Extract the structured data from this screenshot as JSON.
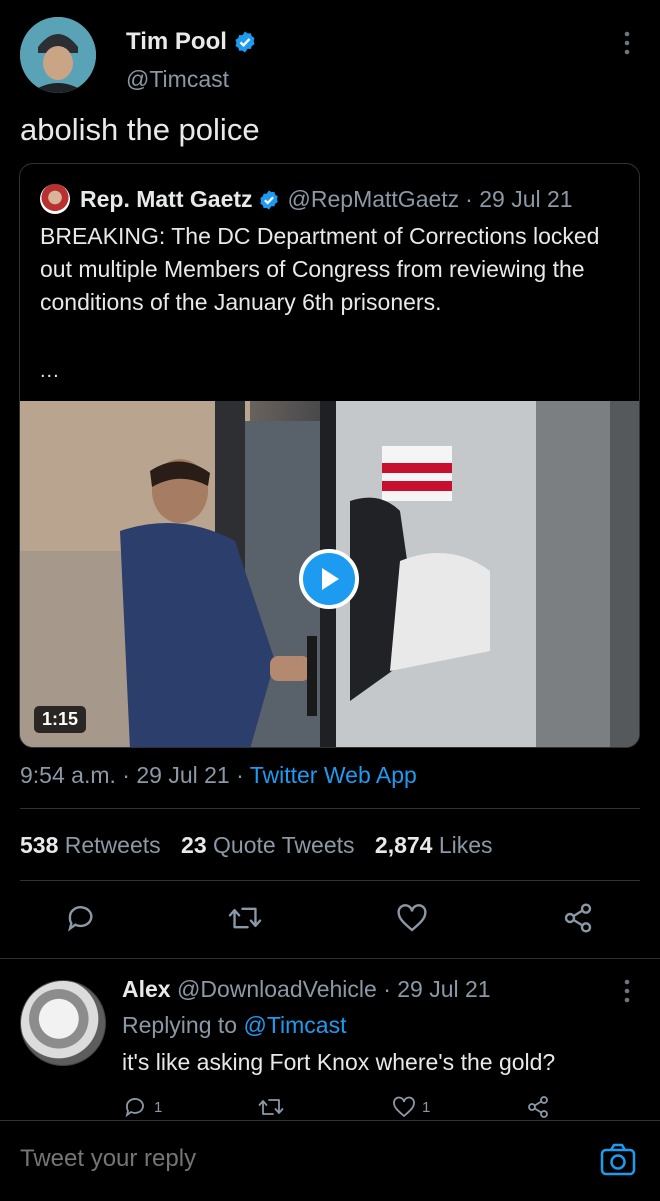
{
  "tweet": {
    "author_name": "Tim Pool",
    "author_handle": "@Timcast",
    "text": "abolish the police",
    "verified": true
  },
  "quote": {
    "author_name": "Rep. Matt Gaetz",
    "author_handle": "@RepMattGaetz",
    "date": "· 29 Jul 21",
    "text": "BREAKING: The DC Department of Corrections locked out multiple Members of Congress from reviewing the conditions of the January 6th prisoners.",
    "ellipsis": "...",
    "video_duration": "1:15"
  },
  "meta": {
    "time": "9:54 a.m.",
    "sep1": " · ",
    "date": "29 Jul 21",
    "sep2": " · ",
    "source": "Twitter Web App"
  },
  "stats": {
    "retweets_count": "538",
    "retweets_label": "Retweets",
    "quotes_count": "23",
    "quotes_label": "Quote Tweets",
    "likes_count": "2,874",
    "likes_label": "Likes"
  },
  "reply": {
    "author_name": "Alex",
    "author_handle": "@DownloadVehicle",
    "date": "· 29 Jul 21",
    "replying_prefix": "Replying to",
    "replying_to": "@Timcast",
    "text": "it's like asking Fort Knox where's the gold?",
    "reply_count": "1",
    "like_count": "1"
  },
  "composer": {
    "placeholder": "Tweet your reply"
  },
  "colors": {
    "background": "#000000",
    "text": "#e7e9ea",
    "muted": "#8b98a5",
    "accent": "#1d9bf0",
    "divider": "#2f3336"
  },
  "icons": [
    "verified-badge-icon",
    "more-vertical-icon",
    "play-icon",
    "reply-icon",
    "retweet-icon",
    "like-icon",
    "share-icon",
    "camera-icon"
  ]
}
